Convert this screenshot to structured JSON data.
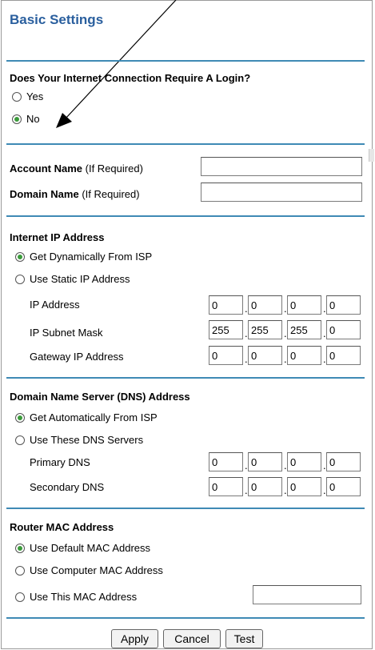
{
  "title": "Basic Settings",
  "login": {
    "heading": "Does Your Internet Connection Require A Login?",
    "options": [
      {
        "label": "Yes",
        "selected": false
      },
      {
        "label": "No",
        "selected": true
      }
    ]
  },
  "account": {
    "account_name_label": "Account Name",
    "account_name_hint": " (If Required)",
    "account_name_value": "",
    "domain_name_label": "Domain Name",
    "domain_name_hint": " (If Required)",
    "domain_name_value": ""
  },
  "ip": {
    "heading": "Internet IP Address",
    "options": [
      {
        "label": "Get Dynamically From ISP",
        "selected": true
      },
      {
        "label": "Use Static IP Address",
        "selected": false
      }
    ],
    "rows": [
      {
        "label": "IP Address",
        "octets": [
          "0",
          "0",
          "0",
          "0"
        ]
      },
      {
        "label": "IP Subnet Mask",
        "octets": [
          "255",
          "255",
          "255",
          "0"
        ]
      },
      {
        "label": "Gateway IP Address",
        "octets": [
          "0",
          "0",
          "0",
          "0"
        ]
      }
    ]
  },
  "dns": {
    "heading": "Domain Name Server (DNS) Address",
    "options": [
      {
        "label": "Get Automatically From ISP",
        "selected": true
      },
      {
        "label": "Use These DNS Servers",
        "selected": false
      }
    ],
    "rows": [
      {
        "label": "Primary DNS",
        "octets": [
          "0",
          "0",
          "0",
          "0"
        ]
      },
      {
        "label": "Secondary DNS",
        "octets": [
          "0",
          "0",
          "0",
          "0"
        ]
      }
    ]
  },
  "mac": {
    "heading": "Router MAC Address",
    "options": [
      {
        "label": "Use Default MAC Address",
        "selected": true
      },
      {
        "label": "Use Computer MAC Address",
        "selected": false
      },
      {
        "label": "Use This MAC Address",
        "selected": false
      }
    ],
    "custom_value": ""
  },
  "buttons": {
    "apply": "Apply",
    "cancel": "Cancel",
    "test": "Test"
  },
  "colors": {
    "title": "#2a5f9e",
    "rule": "#3f8ab5",
    "radio_selected": "#3b9b3b"
  }
}
